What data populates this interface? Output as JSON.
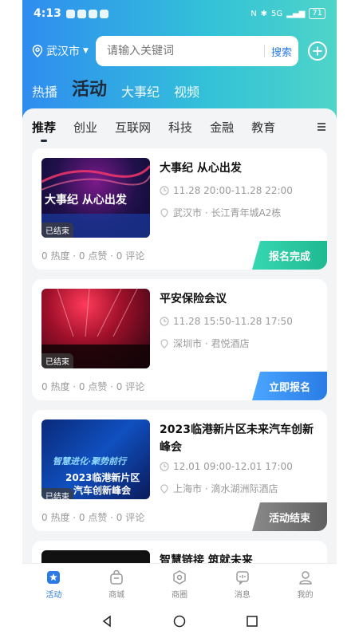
{
  "status": {
    "time": "4:13",
    "battery": "71",
    "network": "5G"
  },
  "header": {
    "city": "武汉市",
    "search_placeholder": "请输入关键词",
    "search_button": "搜索"
  },
  "main_tabs": [
    "热播",
    "活动",
    "大事纪",
    "视频"
  ],
  "categories": [
    "推荐",
    "创业",
    "互联网",
    "科技",
    "金融",
    "教育"
  ],
  "events": [
    {
      "title": "大事纪 从心出发",
      "time": "11.28 20:00-11.28 22:00",
      "location": "武汉市 · 长江青年城A2栋",
      "badge": "已结束",
      "stats": "0 热度 · 0 点赞 · 0 评论",
      "action": "报名完成",
      "thumb_text": "大事纪 从心出发"
    },
    {
      "title": "平安保险会议",
      "time": "11.28 15:50-11.28 17:50",
      "location": "深圳市 · 君悦酒店",
      "badge": "已结束",
      "stats": "0 热度 · 0 点赞 · 0 评论",
      "action": "立即报名",
      "thumb_text": ""
    },
    {
      "title": "2023临港新片区未来汽车创新峰会",
      "time": "12.01 09:00-12.01 17:00",
      "location": "上海市 · 滴水湖洲际酒店",
      "badge": "已结束",
      "stats": "0 热度 · 0 点赞 · 0 评论",
      "action": "活动结束",
      "thumb_text": "智慧进化·聚势前行",
      "thumb_text2": "2023临港新片区",
      "thumb_text3": "汽车创新峰会"
    },
    {
      "title": "智慧链接 筑就未来"
    }
  ],
  "bottom_nav": [
    "活动",
    "商城",
    "商圈",
    "消息",
    "我的"
  ],
  "colors": {
    "accent": "#2c7be5",
    "header_start": "#2f8cf0",
    "header_end": "#4fd4c8"
  }
}
